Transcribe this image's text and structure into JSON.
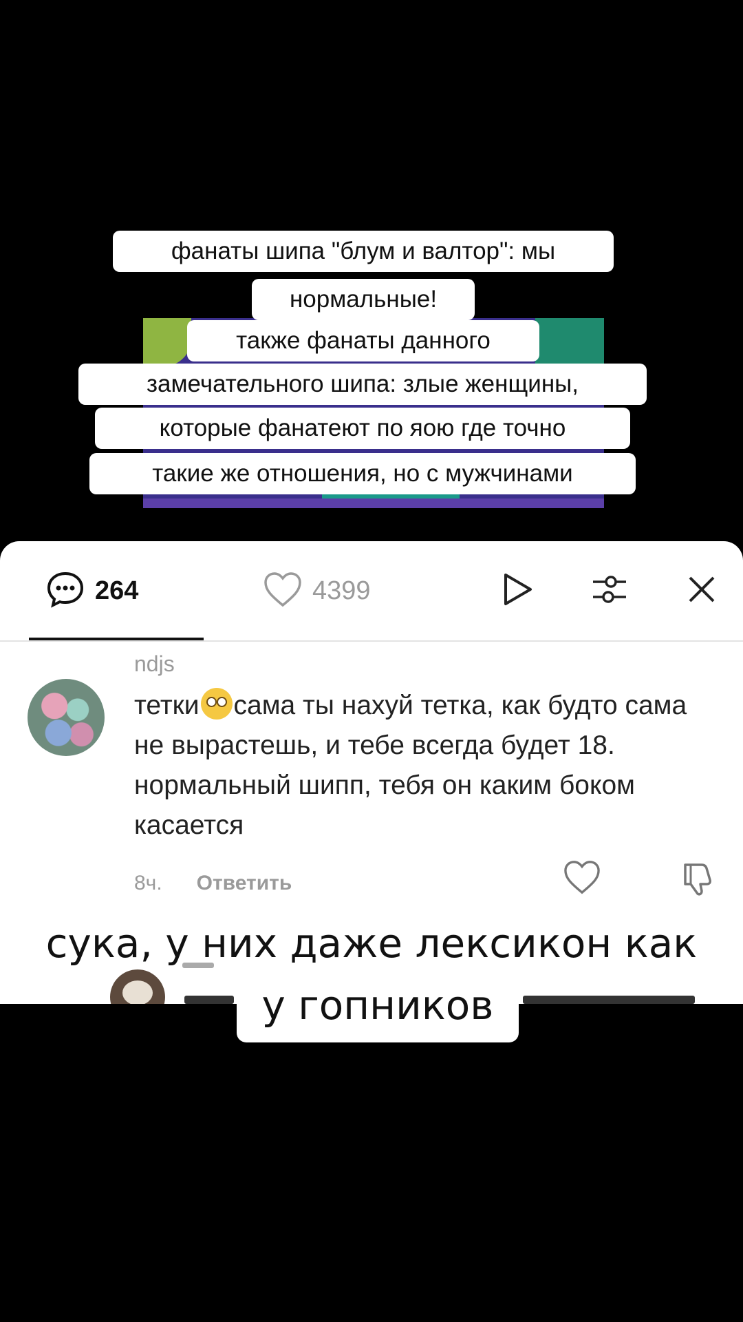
{
  "top_caption": {
    "line1": "фанаты шипа \"блум и валтор\": мы",
    "line2": "нормальные!",
    "line3": "также фанаты данного",
    "line4": "замечательного шипа: злые женщины,",
    "line5": "которые фанатеют по яою где точно",
    "line6": "такие же отношения, но с мужчинами"
  },
  "comments_panel": {
    "comment_count": "264",
    "like_count": "4399",
    "icons": [
      "comment-bubble-icon",
      "heart-icon",
      "play-icon",
      "sliders-icon",
      "close-icon"
    ],
    "comment": {
      "username": "ndjs",
      "text_before_emoji": "тетки",
      "emoji": "face-with-rolling-eyes",
      "text_after_emoji": "сама ты нахуй тетка, как будто сама не вырастешь, и тебе всегда будет 18. нормальный шипп, тебя он каким боком касается",
      "time": "8ч.",
      "reply_label": "Ответить"
    }
  },
  "bottom_caption": {
    "line1": "сука, у них даже лексикон как",
    "line2": "у гопников"
  },
  "colors": {
    "background": "#000000",
    "panel": "#ffffff",
    "muted_text": "#9a9a9a"
  }
}
